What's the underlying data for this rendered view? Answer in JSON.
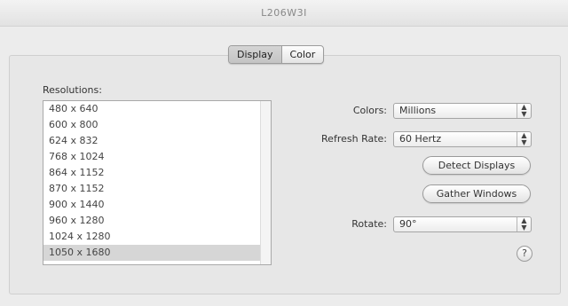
{
  "window": {
    "title": "L206W3I"
  },
  "tabs": [
    {
      "label": "Display",
      "selected": true
    },
    {
      "label": "Color",
      "selected": false
    }
  ],
  "resolutions": {
    "label": "Resolutions:",
    "items": [
      "480 x 640",
      "600 x 800",
      "624 x 832",
      "768 x 1024",
      "864 x 1152",
      "870 x 1152",
      "900 x 1440",
      "960 x 1280",
      "1024 x 1280",
      "1050 x 1680"
    ],
    "selected_index": 9
  },
  "colors": {
    "label": "Colors:",
    "value": "Millions"
  },
  "refresh_rate": {
    "label": "Refresh Rate:",
    "value": "60 Hertz"
  },
  "buttons": {
    "detect_displays": "Detect Displays",
    "gather_windows": "Gather Windows"
  },
  "rotate": {
    "label": "Rotate:",
    "value": "90°"
  },
  "help": {
    "label": "?"
  },
  "icons": {
    "popup_arrow": "up-down-arrows-icon",
    "help": "question-mark-icon"
  }
}
